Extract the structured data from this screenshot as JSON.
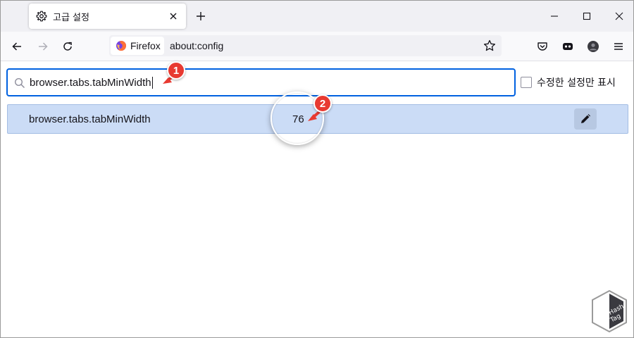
{
  "browser": {
    "tab": {
      "title": "고급 설정",
      "icon": "gear-icon",
      "close_icon": "close-icon"
    },
    "new_tab_icon": "plus-icon",
    "window_controls": [
      "minimize-icon",
      "maximize-icon",
      "close-icon"
    ],
    "nav": [
      "back-arrow-icon",
      "forward-arrow-icon",
      "reload-icon"
    ],
    "identity_label": "Firefox",
    "url": "about:config",
    "toolbar_icons": [
      "pocket-icon",
      "container-icon",
      "account-icon",
      "menu-icon"
    ]
  },
  "config": {
    "search_value": "browser.tabs.tabMinWidth",
    "modified_only_label": "수정한 설정만 표시",
    "modified_only_checked": false,
    "rows": [
      {
        "name": "browser.tabs.tabMinWidth",
        "value": "76",
        "action_icon": "pencil-icon"
      }
    ]
  },
  "annotations": {
    "marker1": "1",
    "marker2": "2",
    "accent_color": "#e83a31"
  },
  "watermark": {
    "line1": "Hash",
    "line2": "Tag"
  },
  "colors": {
    "focus_border": "#0061e0",
    "row_background": "#cbdcf6",
    "tabstrip_background": "#f0f0f4"
  }
}
